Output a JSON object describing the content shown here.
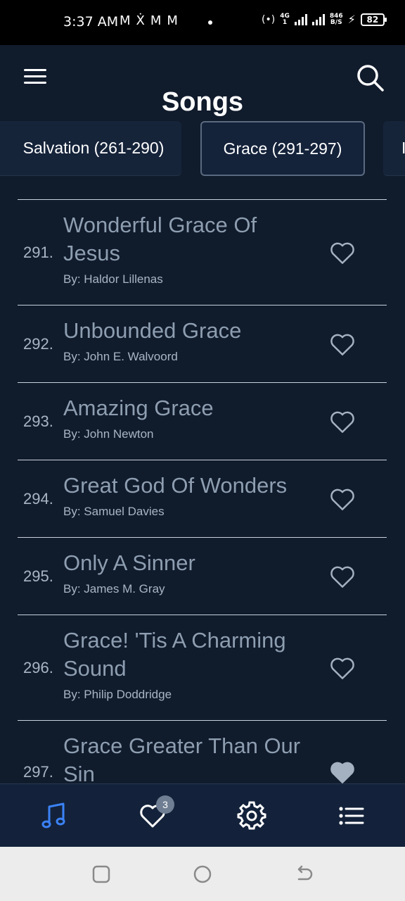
{
  "status_bar": {
    "time": "3:37 AM",
    "notifications": [
      "M",
      "Ẋ",
      "M",
      "M"
    ],
    "network_type_top": "4G",
    "network_type_bottom": "1",
    "speed_value": "846",
    "speed_unit": "B/S",
    "battery": "82"
  },
  "header": {
    "title": "Songs"
  },
  "categories": [
    {
      "label": "Salvation (261-290)",
      "selected": false
    },
    {
      "label": "Grace (291-297)",
      "selected": true
    },
    {
      "label": "I",
      "selected": false
    }
  ],
  "songs": [
    {
      "number": "291.",
      "title": "Wonderful Grace Of Jesus",
      "author": "By: Haldor Lillenas",
      "favorite": false
    },
    {
      "number": "292.",
      "title": "Unbounded Grace",
      "author": "By: John E. Walvoord",
      "favorite": false
    },
    {
      "number": "293.",
      "title": "Amazing Grace",
      "author": "By: John Newton",
      "favorite": false
    },
    {
      "number": "294.",
      "title": "Great God Of Wonders",
      "author": "By: Samuel Davies",
      "favorite": false
    },
    {
      "number": "295.",
      "title": "Only A Sinner",
      "author": "By: James M. Gray",
      "favorite": false
    },
    {
      "number": "296.",
      "title": "Grace! 'Tis A Charming Sound",
      "author": "By: Philip Doddridge",
      "favorite": false
    },
    {
      "number": "297.",
      "title": "Grace Greater Than Our Sin",
      "author": "",
      "favorite": true
    }
  ],
  "bottom_nav": {
    "favorites_badge": "3",
    "items": [
      {
        "icon": "music-note-icon",
        "active": true
      },
      {
        "icon": "heart-icon",
        "active": false
      },
      {
        "icon": "gear-icon",
        "active": false
      },
      {
        "icon": "list-icon",
        "active": false
      }
    ]
  },
  "colors": {
    "background": "#101b2c",
    "accent_active": "#3b82f6",
    "text_muted": "#8e9eb1"
  }
}
